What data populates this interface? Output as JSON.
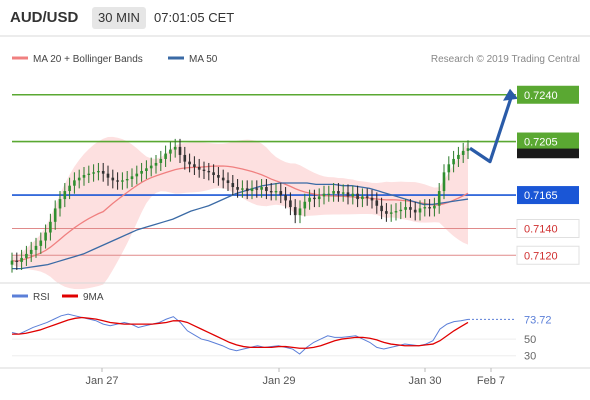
{
  "header": {
    "pair": "AUD/USD",
    "timeframe": "30 MIN",
    "timestamp": "07:01:05 CET"
  },
  "legend": {
    "ma20_label": "MA 20 + Bollinger Bands",
    "ma50_label": "MA 50",
    "research": "Research © 2019 Trading Central",
    "colors": {
      "ma20": "#f08080",
      "ma50": "#3a6aa5",
      "band": "#fde0e0"
    }
  },
  "rsi_legend": {
    "rsi_label": "RSI",
    "ma_label": "9MA",
    "colors": {
      "rsi": "#5b7fd8",
      "ma": "#e00000"
    }
  },
  "chart_data": [
    {
      "type": "candlestick",
      "title": "",
      "ylim": [
        0.71,
        0.726
      ],
      "x_labels": [
        "Jan 27",
        "Jan 29",
        "Jan 30",
        "Feb 7"
      ],
      "levels": [
        {
          "value": "0.7240",
          "kind": "resistance",
          "color": "#5aa832"
        },
        {
          "value": "0.7205",
          "kind": "resistance",
          "color": "#5aa832"
        },
        {
          "value": "0.7165",
          "kind": "pivot",
          "color": "#1a56d6"
        },
        {
          "value": "0.7140",
          "kind": "support",
          "color": "#e08a8a"
        },
        {
          "value": "0.7120",
          "kind": "support",
          "color": "#e08a8a"
        }
      ],
      "last_price": "0.7200",
      "close": [
        0.7116,
        0.7115,
        0.7118,
        0.7121,
        0.7124,
        0.7127,
        0.7131,
        0.7137,
        0.7145,
        0.7155,
        0.7162,
        0.7168,
        0.7172,
        0.7176,
        0.7178,
        0.718,
        0.7181,
        0.7182,
        0.7183,
        0.7181,
        0.7178,
        0.7176,
        0.7175,
        0.7176,
        0.7177,
        0.7179,
        0.7181,
        0.7183,
        0.7185,
        0.7187,
        0.7189,
        0.7192,
        0.7196,
        0.7199,
        0.7201,
        0.7195,
        0.719,
        0.7188,
        0.7186,
        0.7184,
        0.7183,
        0.7182,
        0.718,
        0.7178,
        0.7176,
        0.7174,
        0.7171,
        0.7169,
        0.717,
        0.7168,
        0.717,
        0.7169,
        0.7171,
        0.7168,
        0.7167,
        0.7168,
        0.7165,
        0.7161,
        0.7156,
        0.715,
        0.7155,
        0.716,
        0.7163,
        0.7162,
        0.7164,
        0.7166,
        0.7166,
        0.7168,
        0.7166,
        0.7167,
        0.7164,
        0.7166,
        0.7162,
        0.7164,
        0.7163,
        0.7161,
        0.7157,
        0.7153,
        0.7151,
        0.7152,
        0.7153,
        0.7154,
        0.7156,
        0.7154,
        0.7152,
        0.7155,
        0.7156,
        0.7155,
        0.7157,
        0.7168,
        0.7182,
        0.7188,
        0.7192,
        0.7195,
        0.7198,
        0.72
      ],
      "forecast_path": [
        0.72,
        0.719,
        0.724
      ],
      "ma50": [
        0.711,
        0.711,
        0.7111,
        0.7112,
        0.7113,
        0.7115,
        0.7117,
        0.7119,
        0.7121,
        0.7124,
        0.7127,
        0.713,
        0.7133,
        0.7136,
        0.7139,
        0.7141,
        0.7143,
        0.7145,
        0.7147,
        0.715,
        0.7153,
        0.7155,
        0.7157,
        0.716,
        0.7163,
        0.7166,
        0.7168,
        0.717,
        0.7172,
        0.7173,
        0.7174,
        0.7174,
        0.7174,
        0.7174,
        0.7173,
        0.7173,
        0.7173,
        0.7172,
        0.7172,
        0.7171,
        0.717,
        0.7168,
        0.7166,
        0.7164,
        0.7162,
        0.716,
        0.7158,
        0.7158,
        0.7159,
        0.716,
        0.7161,
        0.7162
      ]
    },
    {
      "type": "line",
      "title": "",
      "ylim": [
        20,
        85
      ],
      "yticks": [
        "50",
        "30"
      ],
      "last_value": "73.72",
      "series": [
        {
          "name": "RSI",
          "values": [
            58,
            56,
            60,
            64,
            67,
            70,
            74,
            78,
            80,
            78,
            76,
            74,
            72,
            68,
            66,
            68,
            70,
            68,
            64,
            66,
            68,
            70,
            74,
            77,
            70,
            60,
            55,
            50,
            48,
            45,
            42,
            38,
            36,
            38,
            40,
            42,
            40,
            41,
            42,
            40,
            38,
            32,
            40,
            46,
            50,
            54,
            52,
            52,
            53,
            54,
            50,
            46,
            40,
            38,
            40,
            42,
            44,
            43,
            42,
            44,
            48,
            62,
            68,
            71,
            72,
            73.72
          ]
        },
        {
          "name": "9MA",
          "values": [
            56,
            56,
            57,
            59,
            61,
            64,
            67,
            70,
            73,
            75,
            76,
            75,
            74,
            72,
            70,
            69,
            68,
            68,
            68,
            68,
            68,
            69,
            70,
            72,
            72,
            70,
            66,
            62,
            58,
            54,
            50,
            46,
            43,
            41,
            40,
            40,
            40,
            40,
            41,
            41,
            40,
            39,
            39,
            40,
            42,
            45,
            48,
            50,
            51,
            52,
            52,
            51,
            49,
            46,
            44,
            43,
            42,
            42,
            42,
            43,
            44,
            48,
            54,
            60,
            65,
            70
          ]
        }
      ]
    }
  ]
}
